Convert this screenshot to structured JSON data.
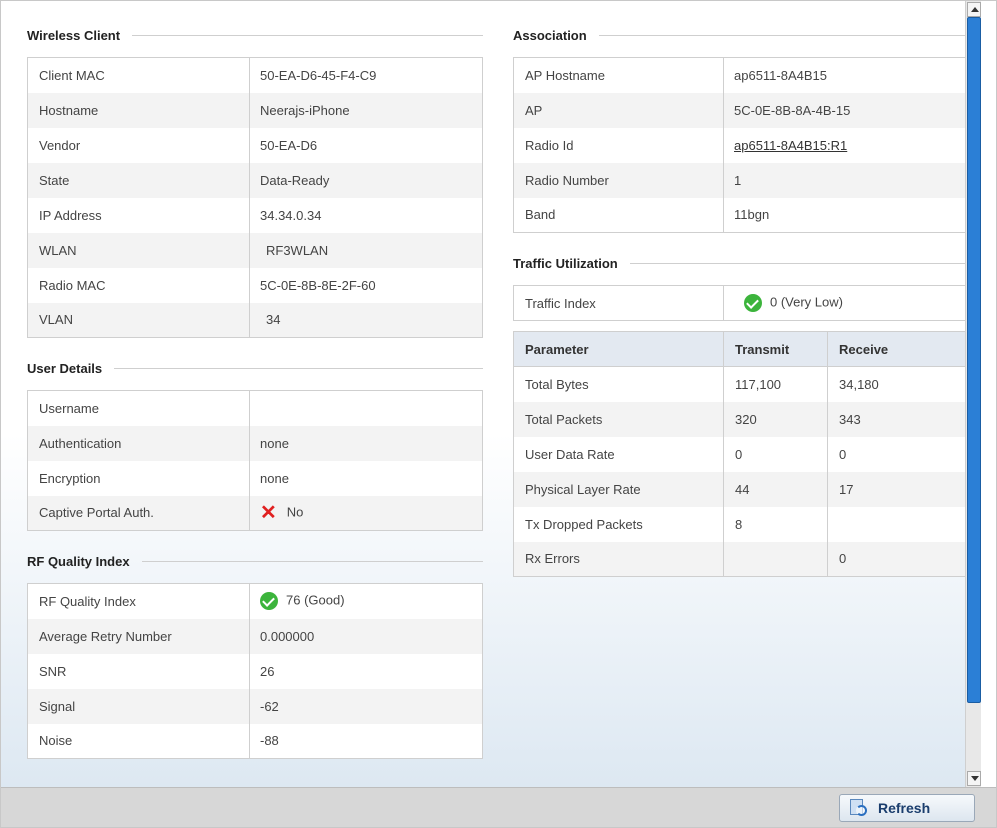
{
  "wireless_client": {
    "title": "Wireless Client",
    "rows": [
      {
        "key": "Client MAC",
        "value": "50-EA-D6-45-F4-C9"
      },
      {
        "key": "Hostname",
        "value": "Neerajs-iPhone"
      },
      {
        "key": "Vendor",
        "value": "50-EA-D6"
      },
      {
        "key": "State",
        "value": "Data-Ready"
      },
      {
        "key": "IP Address",
        "value": "34.34.0.34"
      },
      {
        "key": "WLAN",
        "value": "RF3WLAN"
      },
      {
        "key": "Radio MAC",
        "value": "5C-0E-8B-8E-2F-60"
      },
      {
        "key": "VLAN",
        "value": "34"
      }
    ]
  },
  "user_details": {
    "title": "User Details",
    "rows": [
      {
        "key": "Username",
        "value": ""
      },
      {
        "key": "Authentication",
        "value": "none"
      },
      {
        "key": "Encryption",
        "value": "none"
      },
      {
        "key": "Captive Portal Auth.",
        "value": "No",
        "icon": "x-mark-icon",
        "icon_color": "#e02020"
      }
    ]
  },
  "rf_quality": {
    "title": "RF Quality Index",
    "rows": [
      {
        "key": "RF Quality Index",
        "value": "76 (Good)",
        "icon": "check-circle-icon",
        "icon_color": "#3cb43c"
      },
      {
        "key": "Average Retry Number",
        "value": "0.000000"
      },
      {
        "key": "SNR",
        "value": "26"
      },
      {
        "key": "Signal",
        "value": "-62"
      },
      {
        "key": "Noise",
        "value": "-88"
      }
    ]
  },
  "association": {
    "title": "Association",
    "rows": [
      {
        "key": "AP Hostname",
        "value": "ap6511-8A4B15"
      },
      {
        "key": "AP",
        "value": "5C-0E-8B-8A-4B-15"
      },
      {
        "key": "Radio Id",
        "value": "ap6511-8A4B15:R1",
        "is_link": true
      },
      {
        "key": "Radio Number",
        "value": "1"
      },
      {
        "key": "Band",
        "value": "11bgn"
      }
    ]
  },
  "traffic": {
    "title": "Traffic Utilization",
    "index_label": "Traffic Index",
    "index_value": "0 (Very Low)",
    "index_icon": "check-circle-icon",
    "headers": [
      "Parameter",
      "Transmit",
      "Receive"
    ],
    "rows": [
      [
        "Total Bytes",
        "117,100",
        "34,180"
      ],
      [
        "Total Packets",
        "320",
        "343"
      ],
      [
        "User Data Rate",
        "0",
        "0"
      ],
      [
        "Physical Layer Rate",
        "44",
        "17"
      ],
      [
        "Tx Dropped Packets",
        "8",
        ""
      ],
      [
        "Rx Errors",
        "",
        "0"
      ]
    ]
  },
  "footer": {
    "refresh_label": "Refresh",
    "refresh_icon": "refresh-icon"
  },
  "colors": {
    "accent": "#2b7fd6",
    "header_bg": "#e3e9f1",
    "ok": "#3cb43c",
    "error": "#e02020"
  }
}
